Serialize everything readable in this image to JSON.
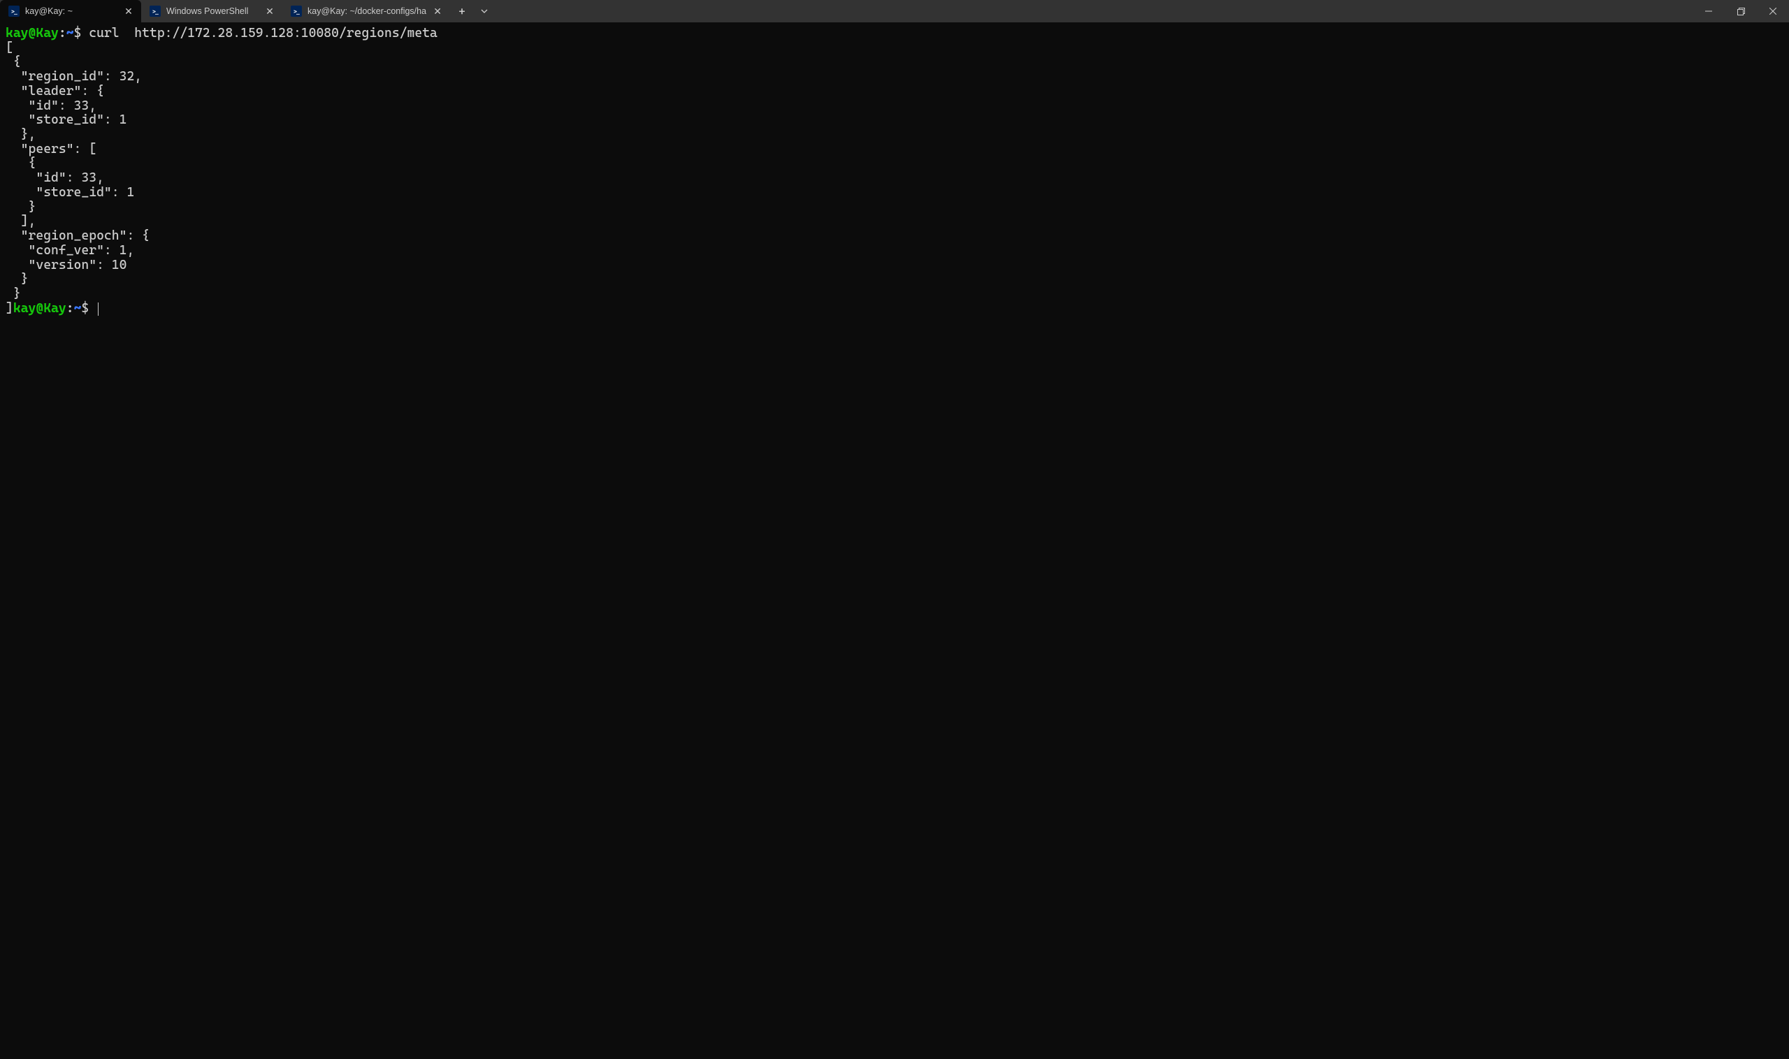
{
  "tabs": [
    {
      "title": "kay@Kay: ~",
      "active": true
    },
    {
      "title": "Windows PowerShell",
      "active": false
    },
    {
      "title": "kay@Kay: ~/docker-configs/ha",
      "active": false
    }
  ],
  "prompt1": {
    "user": "kay@Kay",
    "colon": ":",
    "path": "~",
    "dollar": "$"
  },
  "command": "curl  http://172.28.159.128:10080/regions/meta",
  "output": "[\n {\n  \"region_id\": 32,\n  \"leader\": {\n   \"id\": 33,\n   \"store_id\": 1\n  },\n  \"peers\": [\n   {\n    \"id\": 33,\n    \"store_id\": 1\n   }\n  ],\n  \"region_epoch\": {\n   \"conf_ver\": 1,\n   \"version\": 10\n  }\n }\n]",
  "prompt2": {
    "user": "kay@Kay",
    "colon": ":",
    "path": "~",
    "dollar": "$"
  }
}
